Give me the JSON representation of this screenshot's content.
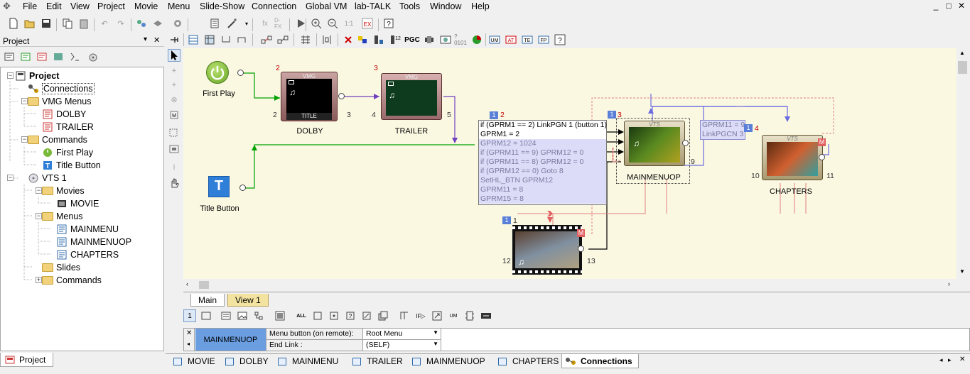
{
  "menubar": {
    "items": [
      "File",
      "Edit",
      "View",
      "Project",
      "Movie",
      "Menu",
      "Slide-Show",
      "Connection",
      "Global VM",
      "lab-TALK",
      "Tools",
      "Window",
      "Help"
    ]
  },
  "window_controls": {
    "minimize": "_",
    "restore": "□",
    "close": "✕"
  },
  "project_panel": {
    "title": "Project",
    "close": "✕",
    "pin": "▾",
    "tree": [
      {
        "label": "Project",
        "icon": "project-icon"
      },
      {
        "label": "Connections",
        "icon": "connections-icon"
      },
      {
        "label": "VMG Menus",
        "icon": "folder-icon"
      },
      {
        "label": "DOLBY",
        "icon": "menu-icon"
      },
      {
        "label": "TRAILER",
        "icon": "menu-icon"
      },
      {
        "label": "Commands",
        "icon": "folder-icon"
      },
      {
        "label": "First Play",
        "icon": "first-play-icon"
      },
      {
        "label": "Title Button",
        "icon": "title-button-icon"
      },
      {
        "label": "VTS 1",
        "icon": "vts-icon"
      },
      {
        "label": "Movies",
        "icon": "folder-icon"
      },
      {
        "label": "MOVIE",
        "icon": "movie-icon"
      },
      {
        "label": "Menus",
        "icon": "folder-icon"
      },
      {
        "label": "MAINMENU",
        "icon": "menu-icon"
      },
      {
        "label": "MAINMENUOP",
        "icon": "menu-icon"
      },
      {
        "label": "CHAPTERS",
        "icon": "menu-icon"
      },
      {
        "label": "Slides",
        "icon": "folder-icon"
      },
      {
        "label": "Commands",
        "icon": "folder-icon"
      }
    ],
    "bottom_tab": "Project"
  },
  "canvas": {
    "first_play": {
      "label": "First Play"
    },
    "title_button": {
      "label": "Title Button"
    },
    "dolby": {
      "label": "DOLBY",
      "tag": "VMG",
      "bar": "TITLE",
      "num_top": "2",
      "num_left": "2",
      "num_right": "3"
    },
    "trailer": {
      "label": "TRAILER",
      "tag": "VMG",
      "num_top": "3",
      "num_left": "4",
      "num_right": "5"
    },
    "mainmenuop": {
      "label": "MAINMENUOP",
      "tag": "VTS",
      "badge": "1",
      "num_top": "3",
      "num_right": "9"
    },
    "chapters": {
      "label": "CHAPTERS",
      "tag": "VTS",
      "badge": "1",
      "num_top": "4",
      "num_left": "10",
      "num_right": "11",
      "m": "M"
    },
    "movie": {
      "badge": "1",
      "num_top": "1",
      "num_left": "12",
      "num_right": "13",
      "m": "M"
    },
    "cmd_badge": "1",
    "cmd_num": "2",
    "cmd_lines": [
      "if (GPRM1 == 2) LinkPGN 1 (button 1)",
      "GPRM1 = 2",
      "GPRM12 = 1024",
      "if (GPRM11 == 9) GPRM12 = 0",
      "if (GPRM11 == 8) GPRM12 = 0",
      "if (GPRM12 == 0) Goto 8",
      "SetHL_BTN GPRM12",
      "GPRM11 = 8",
      "GPRM15 = 8"
    ],
    "gprm_lines": [
      "GPRM11 = 9",
      "LinkPGCN 3"
    ]
  },
  "view_tabs": [
    "Main",
    "View 1"
  ],
  "prop_grid": {
    "object": "MAINMENUOP",
    "rows": [
      {
        "label": "Menu button (on remote):",
        "value": "Root Menu"
      },
      {
        "label": "End Link :",
        "value": "(SELF)"
      }
    ]
  },
  "doc_tabs": [
    "MOVIE",
    "DOLBY",
    "MAINMENU",
    "TRAILER",
    "MAINMENUOP",
    "CHAPTERS",
    "Connections"
  ],
  "doc_tabs_active": "Connections",
  "colors": {
    "canvas_bg": "#fbf8e2",
    "link_green": "#00a000",
    "link_purple": "#7040c0",
    "link_blue": "#6a6ae0",
    "link_red": "#e06060"
  }
}
